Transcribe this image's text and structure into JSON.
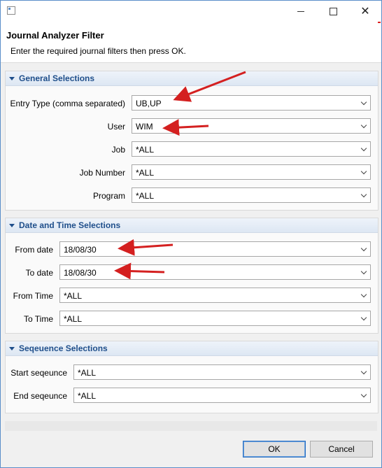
{
  "window": {
    "title_icon": "app-window-icon",
    "minimize": "minimize",
    "maximize": "maximize",
    "close": "close"
  },
  "header": {
    "title": "Journal Analyzer Filter",
    "message": "Enter the required journal filters then press OK."
  },
  "general": {
    "title": "General Selections",
    "fields": [
      {
        "label": "Entry Type (comma separated)",
        "value": "UB,UP"
      },
      {
        "label": "User",
        "value": "WIM"
      },
      {
        "label": "Job",
        "value": "*ALL"
      },
      {
        "label": "Job Number",
        "value": "*ALL"
      },
      {
        "label": "Program",
        "value": "*ALL"
      }
    ]
  },
  "datetime": {
    "title": "Date and Time Selections",
    "fields": [
      {
        "label": "From date",
        "value": "18/08/30"
      },
      {
        "label": "To date",
        "value": "18/08/30"
      },
      {
        "label": "From Time",
        "value": "*ALL"
      },
      {
        "label": "To Time",
        "value": "*ALL"
      }
    ]
  },
  "sequence": {
    "title": "Seqeuence Selections",
    "fields": [
      {
        "label": "Start seqeunce",
        "value": "*ALL"
      },
      {
        "label": "End seqeunce",
        "value": "*ALL"
      }
    ]
  },
  "buttons": {
    "ok": "OK",
    "cancel": "Cancel"
  },
  "colors": {
    "accent": "#1f4f8b",
    "annotation": "#d42020"
  }
}
